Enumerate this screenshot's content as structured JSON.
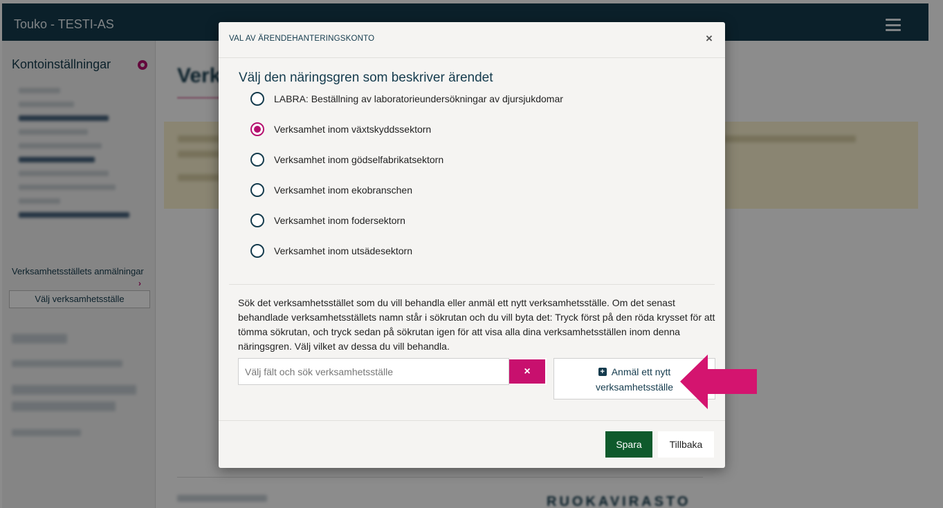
{
  "app": {
    "title": "Touko - TESTI-AS"
  },
  "sidebar": {
    "heading": "Kontoinställningar",
    "announcements_link": "Verksamhetsställets anmälningar",
    "chevron": "›",
    "select_site_button": "Välj verksamhetsställe"
  },
  "modal": {
    "title": "VAL AV ÄRENDEHANTERINGSKONTO",
    "close_label": "×",
    "section_title": "Välj den näringsgren som beskriver ärendet",
    "options": [
      {
        "label": "LABRA: Beställning av laboratorieundersökningar av djursjukdomar",
        "selected": false
      },
      {
        "label": "Verksamhet inom växtskyddssektorn",
        "selected": true
      },
      {
        "label": "Verksamhet inom gödselfabrikatsektorn",
        "selected": false
      },
      {
        "label": "Verksamhet inom ekobranschen",
        "selected": false
      },
      {
        "label": "Verksamhet inom fodersektorn",
        "selected": false
      },
      {
        "label": "Verksamhet inom utsädesektorn",
        "selected": false
      }
    ],
    "help_text": "Sök det verksamhetsstället som du vill behandla eller anmäl ett nytt verksamhetsställe. Om det senast behandlade verksamhetsställets namn står i sökrutan och du vill byta det: Tryck först på den röda krysset för att tömma sökrutan, och tryck sedan på sökrutan igen för att visa alla dina verksamhetsställen inom denna näringsgren. Välj vilket av dessa du vill behandla.",
    "search": {
      "placeholder": "Välj fält och sök verksamhetsställe",
      "value": ""
    },
    "clear_label": "×",
    "new_site_button": {
      "icon": "plus-square",
      "line1": "Anmäl ett nytt",
      "line2": "verksamhetsställe"
    },
    "save_label": "Spara",
    "back_label": "Tillbaka"
  },
  "footer": {
    "logo_text": "RUOKAVIRASTO"
  },
  "colors": {
    "header_bg": "#143b4d",
    "accent_magenta": "#b5106e",
    "save_green": "#0e5a2c",
    "annotation_arrow": "#d4146f"
  }
}
